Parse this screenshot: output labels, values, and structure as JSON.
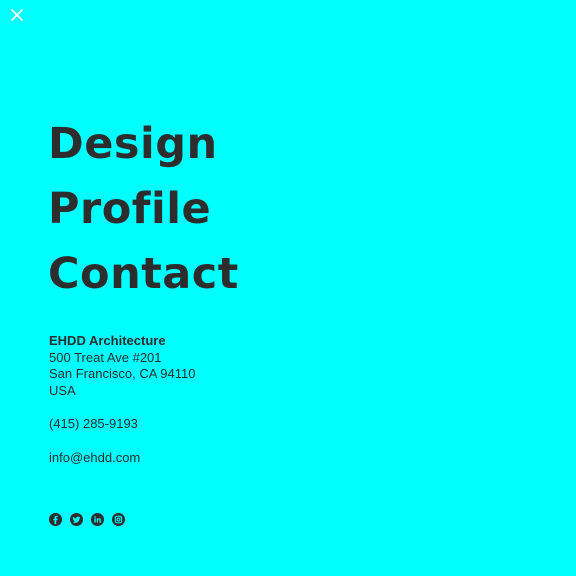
{
  "close": {
    "icon": "close-icon"
  },
  "nav": {
    "items": [
      {
        "label": "Design"
      },
      {
        "label": "Profile"
      },
      {
        "label": "Contact"
      }
    ]
  },
  "contact": {
    "firm": "EHDD Architecture",
    "address_line1": "500 Treat Ave #201",
    "address_line2": "San Francisco, CA 94110",
    "country": "USA",
    "phone": "(415) 285-9193",
    "email": "info@ehdd.com"
  },
  "social": {
    "icons": [
      "facebook-icon",
      "twitter-icon",
      "linkedin-icon",
      "instagram-icon"
    ]
  },
  "colors": {
    "background": "#00ffff",
    "text": "#2d2d2d"
  }
}
